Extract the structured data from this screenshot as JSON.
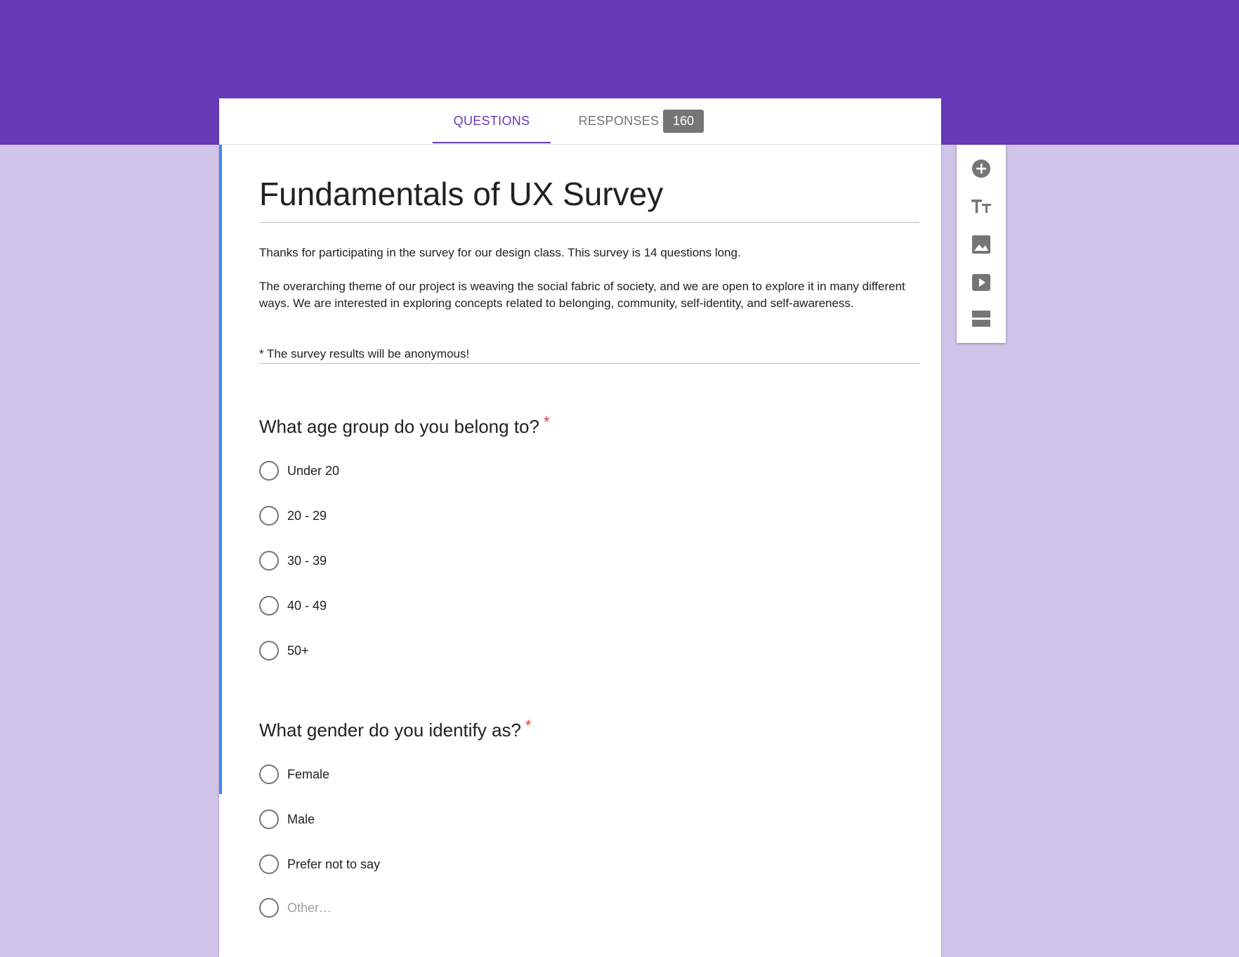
{
  "colors": {
    "header": "#673ab7",
    "background": "#d1c4e9",
    "accent_bar": "#4285f4",
    "required": "#db4437",
    "icon_gray": "#757575"
  },
  "tabs": {
    "questions_label": "QUESTIONS",
    "responses_label": "RESPONSES",
    "responses_count": "160"
  },
  "form": {
    "title": "Fundamentals of UX Survey",
    "description": [
      "Thanks for participating in the survey for our design class. This survey is 14 questions long.",
      "The overarching theme of our project is weaving the social fabric of society, and we are open to explore it in many different ways. We are interested in exploring concepts related to belonging, community, self-identity, and self-awareness.",
      "* The survey results will be anonymous!"
    ]
  },
  "questions": [
    {
      "title": "What age group do you belong to?",
      "required_mark": "*",
      "options": [
        "Under 20",
        "20 - 29",
        "30 - 39",
        "40 - 49",
        "50+"
      ]
    },
    {
      "title": "What gender do you identify as?",
      "required_mark": "*",
      "options": [
        "Female",
        "Male",
        "Prefer not to say"
      ],
      "other_placeholder": "Other…"
    }
  ],
  "toolbar": {
    "icons": [
      "add-question-icon",
      "add-title-icon",
      "add-image-icon",
      "add-video-icon",
      "add-section-icon"
    ]
  }
}
